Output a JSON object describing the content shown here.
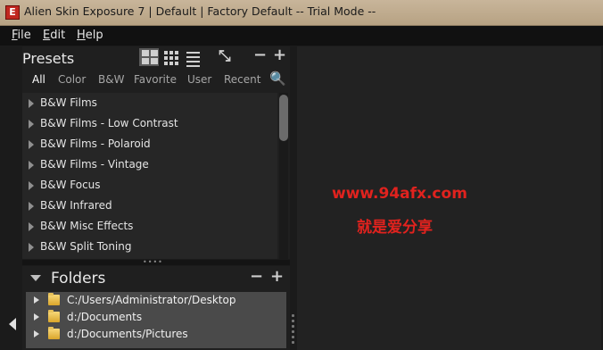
{
  "window": {
    "app_icon_letter": "E",
    "title": "Alien Skin Exposure 7 | Default | Factory Default -- Trial Mode --"
  },
  "menu": {
    "items": [
      {
        "label": "File",
        "mnemonic": "F",
        "rest": "ile"
      },
      {
        "label": "Edit",
        "mnemonic": "E",
        "rest": "dit"
      },
      {
        "label": "Help",
        "mnemonic": "H",
        "rest": "elp"
      }
    ]
  },
  "presets": {
    "title": "Presets",
    "tabs": [
      "All",
      "Color",
      "B&W",
      "Favorite",
      "User",
      "Recent"
    ],
    "active_tab": "All",
    "items": [
      "B&W Films",
      "B&W Films - Low Contrast",
      "B&W Films - Polaroid",
      "B&W Films - Vintage",
      "B&W Focus",
      "B&W Infrared",
      "B&W Misc Effects",
      "B&W Split Toning"
    ],
    "remove_glyph": "−",
    "add_glyph": "+",
    "collapse_glyph": "⤡",
    "search_glyph": "🔍"
  },
  "folders": {
    "title": "Folders",
    "remove_glyph": "−",
    "add_glyph": "+",
    "items": [
      "C:/Users/Administrator/Desktop",
      "d:/Documents",
      "d:/Documents/Pictures"
    ]
  },
  "watermark": {
    "url": "www.94afx.com",
    "tagline": "就是爱分享",
    "color": "#e1221e"
  }
}
